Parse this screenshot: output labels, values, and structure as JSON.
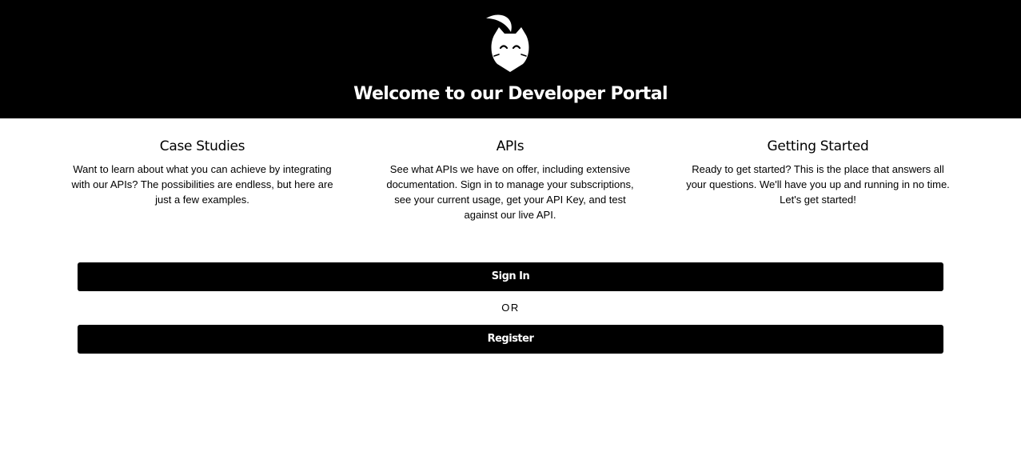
{
  "header": {
    "title": "Welcome to our Developer Portal",
    "logo_icon": "cat-mascot-icon"
  },
  "features": [
    {
      "title": "Case Studies",
      "text": "Want to learn about what you can achieve by integrating with our APIs? The possibilities are endless, but here are just a few examples."
    },
    {
      "title": "APIs",
      "text": "See what APIs we have on offer, including extensive documentation. Sign in to manage your subscriptions, see your current usage, get your API Key, and test against our live API."
    },
    {
      "title": "Getting Started",
      "text": "Ready to get started? This is the place that answers all your questions. We'll have you up and running in no time. Let's get started!"
    }
  ],
  "actions": {
    "signin_label": "Sign In",
    "or_label": "OR",
    "register_label": "Register"
  },
  "colors": {
    "header_bg": "#000000",
    "button_bg": "#000000",
    "button_text": "#ffffff",
    "page_bg": "#ffffff"
  }
}
